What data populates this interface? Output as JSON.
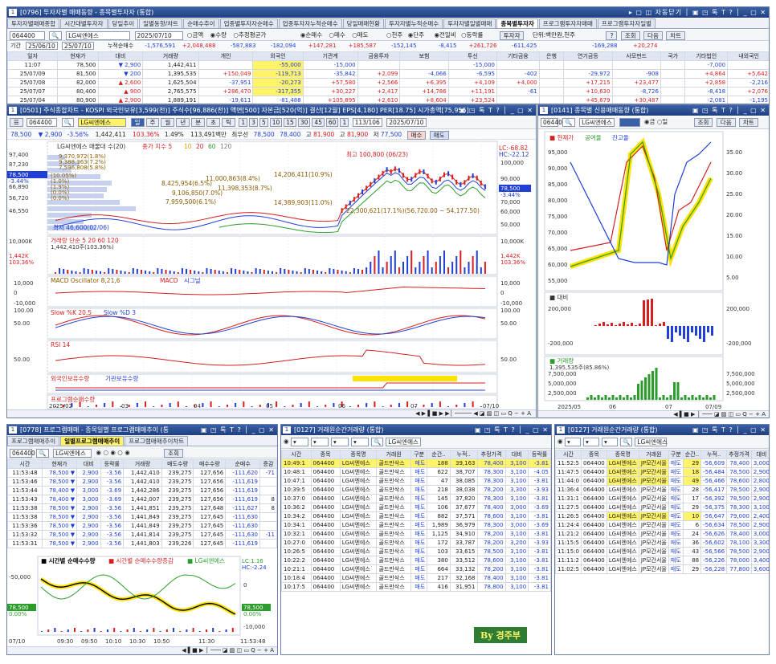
{
  "main_window": {
    "num": "1",
    "title": "[0796] 투자자별 매매동향 - 종목별투자자 (통합)",
    "ctrl": "▸ ▢ ◫ 자동닫기 │ ▣ ◳ 톡 T ? │ _ ▢ ✕"
  },
  "main_tabs": [
    "투자자별매매종합",
    "시간대별투자자",
    "당일추이",
    "일별동향/차트",
    "순매수추이",
    "업종별투자자순매수",
    "업종투자자누적순매수",
    "당일매매현황",
    "투자자별누적순매수",
    "투자자별일별매매",
    "종목별투자자",
    "프로그램투자자매매",
    "프로그램투자자일별"
  ],
  "main_toolbar": {
    "code": "064400",
    "name": "LG씨엔에스",
    "date": "2025/07/10",
    "radios": [
      "금액",
      "수량",
      "추정평균가"
    ],
    "radios2": [
      "순매수",
      "매수",
      "매도"
    ],
    "radios3": [
      "천주",
      "단주"
    ],
    "radios4": [
      "전일비",
      "등락률"
    ],
    "btn_investor": "투자자",
    "unit_note": "단위:백만원,천주",
    "query": "?",
    "btn1": "조회",
    "btn2": "다음",
    "btn3": "차트"
  },
  "period": {
    "label": "기간",
    "from": "25/06/10",
    "to": "25/07/10",
    "cum_label": "누적순매수",
    "sums": [
      "-1,576,591",
      "+2,048,488",
      "-587,883",
      "-182,094",
      "+147,281",
      "+185,587",
      "-152,145",
      "-8,415",
      "+261,726",
      "-611,425",
      "",
      "-169,288",
      "+20,274"
    ]
  },
  "main_table": {
    "headers": [
      "일자",
      "현재가",
      "대비",
      "거래량",
      "개인",
      "외국인",
      "기관계",
      "금융투자",
      "보험",
      "투신",
      "기타금융",
      "은행",
      "연기금등",
      "사모펀드",
      "국가",
      "기타법인",
      "내외국인"
    ],
    "rows": [
      [
        "11:07",
        "78,500",
        "▼ 2,900",
        "1,442,411",
        "",
        "-55,000",
        "-15,000",
        "",
        "",
        "-15,000",
        "",
        "",
        "",
        "",
        "",
        "-7,000",
        ""
      ],
      [
        "25/07/09",
        "81,500",
        "▼ 200",
        "1,395,535",
        "+150,049",
        "-119,713",
        "-35,842",
        "+2,099",
        "-4,066",
        "-6,595",
        "-402",
        "",
        "-29,972",
        "-908",
        "",
        "+4,864",
        "+5,642"
      ],
      [
        "25/07/08",
        "82,000",
        "▲ 2,600",
        "1,625,504",
        "-37,951",
        "-20,273",
        "+57,580",
        "+2,566",
        "+6,395",
        "+4,109",
        "+4,000",
        "",
        "+17,215",
        "+23,477",
        "",
        "+2,858",
        "-2,216"
      ],
      [
        "25/07/07",
        "80,400",
        "▲ 900",
        "2,765,575",
        "+286,470",
        "-317,355",
        "+30,227",
        "+2,417",
        "+14,786",
        "+11,191",
        "-61",
        "",
        "+10,630",
        "-8,726",
        "",
        "-8,418",
        "+2,076"
      ],
      [
        "25/07/04",
        "80,900",
        "▲ 2,900",
        "1,889,191",
        "-19,611",
        "-81,488",
        "+105,895",
        "+2,610",
        "+8,604",
        "+23,524",
        "",
        "",
        "+45,679",
        "+30,487",
        "",
        "-2,081",
        "-1,195"
      ]
    ]
  },
  "chart_window": {
    "num": "1",
    "title": "[0501] 주식종합차트 - KOSPI 외국인보유[3,599(천)] 주식수[96,886(천)] 액면[500] 자본금[520(억)] 결산[12월] EPS[4,180] PER[18.75] 시가총액[75,955]",
    "ctrl": "▣ ◳ 톡 T ? │ _ ▢ ✕"
  },
  "chart_toolbar": {
    "code": "064400",
    "name": "LG씨엔에스",
    "periods": [
      "일",
      "주",
      "월",
      "년",
      "분",
      "초",
      "틱"
    ],
    "nums": [
      "1",
      "3",
      "5",
      "10",
      "15",
      "30",
      "45",
      "60",
      "1"
    ],
    "count": "113/106",
    "date": "2025/07/10"
  },
  "quote": {
    "price": "78,500",
    "change": "▼ 2,900",
    "pct": "-3.56%",
    "volume": "1,442,411",
    "vol_pct": "103.36%",
    "vol_ratio": "1.49%",
    "amount": "113,491백만",
    "close_label": "최우선",
    "ask": "78,500",
    "bid": "78,400",
    "high_label": "고",
    "high": "81,900",
    "high2": "81,900",
    "low_label": "저",
    "low": "77,500",
    "buy": "매수",
    "sell": "매도"
  },
  "price_panel": {
    "legend": [
      "LG씨엔에스 매물대 수(20)",
      "종가 지수 5",
      "10",
      "20",
      "60",
      "120"
    ],
    "lc": "LC:-68.82",
    "hc": "HC:-22.12",
    "current_price": "78,500",
    "current_change": "-3.44%",
    "left_axis": [
      "97,400",
      "87,230",
      "78,500",
      "-3.44%",
      "66,890",
      "56,720",
      "46,550"
    ],
    "right_axis": [
      "100,000",
      "90,000",
      "78,500",
      "-3.44%",
      "70,000",
      "60,000",
      "50,000"
    ],
    "annotations": [
      "최고 100,800 (06/23)",
      "11,000,863(8.4%)",
      "14,206,411(10.9%)",
      "8,425,954(6.5%)",
      "11,398,353(8.7%)",
      "9,106,850(7.0%)",
      "7,959,500(6.1%)",
      "14,389,903(11.0%)",
      "22,300,621(17.1%)(56,720.00 ~ 54,177.50)",
      "최저 46,600(02/06)"
    ],
    "vol_left": "9,370,972(1.8%)",
    "vol_left2": "9,388,363(7.2%)",
    "vol_left3": "7,596,808(5.8%)",
    "pcts": [
      "(10.05%)",
      "(1.0%)",
      "(1.9%)",
      "(0.0%)",
      "(0.0%)"
    ]
  },
  "volume_panel": {
    "legend": "거래량 단순 5 20 60 120",
    "value": "1,442,410주(103.36%)",
    "left_axis": [
      "10,000K",
      "1,442K",
      "103.36%"
    ],
    "right_axis": [
      "10,000K",
      "1,442K",
      "103.36%"
    ]
  },
  "macd_panel": {
    "legend": [
      "MACD Oscillator 8,21,6",
      "MACD",
      "시그널"
    ],
    "left_axis": [
      "10,000",
      "0",
      "-10,000"
    ],
    "right_axis": [
      "10,000",
      "0",
      "-10,000"
    ]
  },
  "slow_panel": {
    "legend": [
      "Slow %K 20,5",
      "Slow %D 3"
    ],
    "left_axis": [
      "100.00",
      "50.00"
    ],
    "right_axis": [
      "100.00",
      "50.00"
    ]
  },
  "rsi_panel": {
    "legend": "RSI 14",
    "left_axis": [
      "50.00"
    ],
    "right_axis": [
      "50.00"
    ]
  },
  "foreign_panel": {
    "legend": [
      "외국인보유수량",
      "기관보유수량"
    ]
  },
  "program_panel": {
    "legend": "프로그램순매수량"
  },
  "x_axis": [
    "2025/02",
    "03",
    "04",
    "05",
    "06",
    "07",
    "07/10"
  ],
  "credit_window": {
    "num": "1",
    "title": "[0141] 종목별 신용매매동향 (통합)",
    "ctrl": "▣ ◳ 톡 T ? │ _ ▢ ✕"
  },
  "credit_toolbar": {
    "code": "064400",
    "name": "LG씨엔에스",
    "radios": [
      "금",
      "O",
      "일"
    ],
    "btn1": "조회",
    "btn2": "다음",
    "btn3": "차트"
  },
  "credit_panel": {
    "legend": [
      "현재가",
      "공여율",
      "잔고율"
    ],
    "left_axis": [
      "95,000",
      "90,000",
      "85,000",
      "80,000",
      "75,000",
      "70,000",
      "65,000",
      "60,000",
      "55,000"
    ],
    "right_axis": [
      "35.00",
      "30.00",
      "25.00",
      "20.00",
      "15.00",
      "10.00",
      "5.00"
    ],
    "diff_legend": "대비",
    "diff_axis": [
      "200,000",
      "-200,000"
    ],
    "diff_axis_r": [
      "200,000",
      "-200,000"
    ],
    "vol_legend": "거래량",
    "vol_value": "1,395,535주(85.86%)",
    "vol_axis": [
      "7,500,000",
      "5,000,000",
      "2,500,000"
    ],
    "x": [
      "2025/05",
      "06",
      "07",
      "07/09"
    ]
  },
  "program_window": {
    "num": "1",
    "title": "[0778] 프로그램매매 - 종목일별 프로그램매매추이 (통",
    "ctrl": "▣ ◳ 톡 T ? │ _ ▢ ✕"
  },
  "program_tabs": [
    "프로그램매매추이",
    "일별프로그램매매추이",
    "프로그램매매추이차트"
  ],
  "program_table": {
    "headers": [
      "시간",
      "현재가",
      "대비",
      "등락률",
      "거래량",
      "매도수량",
      "매수수량",
      "순매수",
      "증감"
    ],
    "rows": [
      [
        "11:53:48",
        "78,500 ▼",
        "2,900",
        "-3.56",
        "1,442,410",
        "239,275",
        "127,656",
        "-111,620",
        "-71"
      ],
      [
        "11:53:46",
        "78,500 ▼",
        "2,900",
        "-3.56",
        "1,442,410",
        "239,275",
        "127,656",
        "-111,619",
        ""
      ],
      [
        "11:53:44",
        "78,400 ▼",
        "3,000",
        "-3.69",
        "1,442,286",
        "239,275",
        "127,656",
        "-111,619",
        ""
      ],
      [
        "11:53:43",
        "78,400 ▼",
        "3,000",
        "-3.69",
        "1,442,007",
        "239,275",
        "127,656",
        "-111,619",
        "8"
      ],
      [
        "11:53:38",
        "78,500 ▼",
        "2,900",
        "-3.56",
        "1,441,851",
        "239,275",
        "127,648",
        "-111,627",
        "8"
      ],
      [
        "11:53:38",
        "78,500 ▼",
        "2,900",
        "-3.56",
        "1,441,849",
        "239,275",
        "127,645",
        "-111,630",
        ""
      ],
      [
        "11:53:36",
        "78,500 ▼",
        "2,900",
        "-3.56",
        "1,441,849",
        "239,275",
        "127,645",
        "-111,630",
        ""
      ],
      [
        "11:53:32",
        "78,500 ▼",
        "2,900",
        "-3.56",
        "1,441,814",
        "239,275",
        "127,645",
        "-111,630",
        "-11"
      ],
      [
        "11:53:31",
        "78,500 ▼",
        "2,900",
        "-3.56",
        "1,441,803",
        "239,226",
        "127,645",
        "-111,619",
        ""
      ]
    ]
  },
  "program_chart": {
    "legend": [
      "시간별 순매수수량",
      "시간별 순매수수량증감",
      "LG씨엔에스"
    ],
    "lc": "LC:1.16",
    "hc": "HC:-2.24",
    "left_axis": [
      "-50,000",
      "78,500",
      "0.00%"
    ],
    "right_axis": [
      "0",
      "78,500",
      "0.00%",
      "-10,000"
    ],
    "x": [
      "07/10",
      "09:30",
      "09:50",
      "10:10",
      "10:30",
      "10:50",
      "11:30",
      "11:53:48"
    ]
  },
  "trade_window1": {
    "num": "1",
    "title": "[0127] 거래원순간거래량 (통합)",
    "ctrl": "▣ ◳ 톡 T ? │ _ ▢ ✕"
  },
  "trade_window2": {
    "num": "1",
    "title": "[0127] 거래원순간거래량 (통합)",
    "ctrl": "▣ ◳ 톡 T ? │ _ ▢ ✕"
  },
  "trade_headers": [
    "시간",
    "종목",
    "종목명",
    "거래원",
    "구분",
    "순간..",
    "누적..",
    "추정가격",
    "대비",
    "등락률"
  ],
  "trade_rows1": [
    [
      "10:49:1",
      "064400",
      "LG씨엔에스",
      "골드만삭스",
      "매도",
      "188",
      "39,163",
      "78,400",
      "3,100",
      "-3.81"
    ],
    [
      "10:48:1",
      "064400",
      "LG씨엔에스",
      "골드만삭스",
      "매도",
      "622",
      "38,707",
      "78,300",
      "3,100",
      "-4.05"
    ],
    [
      "10:47:1",
      "064400",
      "LG씨엔에스",
      "골드만삭스",
      "매도",
      "47",
      "38,085",
      "78,300",
      "3,100",
      "-3.81"
    ],
    [
      "10:39:5",
      "064400",
      "LG씨엔에스",
      "골드만삭스",
      "매도",
      "218",
      "38,038",
      "78,200",
      "3,300",
      "-3.93"
    ],
    [
      "10:37:0",
      "064400",
      "LG씨엔에스",
      "골드만삭스",
      "매도",
      "145",
      "37,820",
      "78,300",
      "3,100",
      "-3.81"
    ],
    [
      "10:36:2",
      "064400",
      "LG씨엔에스",
      "골드만삭스",
      "매도",
      "106",
      "37,677",
      "78,400",
      "3,000",
      "-3.69"
    ],
    [
      "10:34:2",
      "064400",
      "LG씨엔에스",
      "골드만삭스",
      "매도",
      "882",
      "37,571",
      "78,600",
      "3,100",
      "-3.81"
    ],
    [
      "10:34:1",
      "064400",
      "LG씨엔에스",
      "골드만삭스",
      "매도",
      "1,989",
      "36,979",
      "78,300",
      "3,000",
      "-3.69"
    ],
    [
      "10:32:1",
      "064400",
      "LG씨엔에스",
      "골드만삭스",
      "매도",
      "1,125",
      "34,910",
      "78,200",
      "3,100",
      "-3.81"
    ],
    [
      "10:27:0",
      "064400",
      "LG씨엔에스",
      "골드만삭스",
      "매도",
      "172",
      "33,787",
      "78,200",
      "3,200",
      "-3.93"
    ],
    [
      "10:26:5",
      "064400",
      "LG씨엔에스",
      "골드만삭스",
      "매도",
      "103",
      "33,615",
      "78,500",
      "3,100",
      "-3.81"
    ],
    [
      "10:22:2",
      "064400",
      "LG씨엔에스",
      "골드만삭스",
      "매도",
      "380",
      "33,512",
      "78,600",
      "3,100",
      "-3.81"
    ],
    [
      "10:21:1",
      "064400",
      "LG씨엔에스",
      "골드만삭스",
      "매도",
      "664",
      "33,132",
      "78,200",
      "3,100",
      "-3.81"
    ],
    [
      "10:18:4",
      "064400",
      "LG씨엔에스",
      "골드만삭스",
      "매도",
      "217",
      "32,168",
      "78,400",
      "3,100",
      "-3.81"
    ],
    [
      "10:17:5",
      "064400",
      "LG씨엔에스",
      "골드만삭스",
      "매도",
      "416",
      "31,951",
      "78,800",
      "3,100",
      "-3.81"
    ]
  ],
  "trade_rows2": [
    [
      "11:52:5",
      "064400",
      "LG씨엔에스",
      "JP모간서울",
      "매도",
      "29",
      "-56,609",
      "78,400",
      "3,000",
      "-3.69"
    ],
    [
      "11:47:5",
      "064400",
      "LG씨엔에스",
      "JP모간서울",
      "매도",
      "18",
      "-56,484",
      "78,500",
      "2,900",
      "-3.56"
    ],
    [
      "11:44:0",
      "064400",
      "LG씨엔에스",
      "JP모간서울",
      "매도",
      "49",
      "-56,466",
      "78,600",
      "2,800",
      "-3.44"
    ],
    [
      "11:36:4",
      "064400",
      "LG씨엔에스",
      "JP모간서울",
      "매도",
      "28",
      "-56,417",
      "78,500",
      "2,900",
      "-3.56"
    ],
    [
      "11:31:1",
      "064400",
      "LG씨엔에스",
      "JP모간서울",
      "매도",
      "17",
      "-56,392",
      "78,500",
      "2,900",
      "-3.56"
    ],
    [
      "11:27:5",
      "064400",
      "LG씨엔에스",
      "JP모간서울",
      "매도",
      "29",
      "-56,375",
      "78,300",
      "3,100",
      "-3.81"
    ],
    [
      "11:26:5",
      "064400",
      "LG씨엔에스",
      "JP모간서울",
      "매도",
      "10",
      "-56,647",
      "79,000",
      "2,400",
      "-2.95"
    ],
    [
      "11:24:4",
      "064400",
      "LG씨엔에스",
      "JP모간서울",
      "매도",
      "6",
      "-56,634",
      "78,500",
      "2,900",
      "-3.56"
    ],
    [
      "11:21:2",
      "064400",
      "LG씨엔에스",
      "JP모간서울",
      "매도",
      "24",
      "-56,626",
      "78,400",
      "3,000",
      "-3.69"
    ],
    [
      "11:15:5",
      "064400",
      "LG씨엔에스",
      "JP모간서울",
      "매도",
      "36",
      "-56,602",
      "78,100",
      "3,300",
      "-4.05"
    ],
    [
      "11:15:0",
      "064400",
      "LG씨엔에스",
      "JP모간서울",
      "매도",
      "43",
      "-56,566",
      "78,500",
      "2,900",
      "-3.56"
    ],
    [
      "11:11:2",
      "064400",
      "LG씨엔에스",
      "JP모간서울",
      "매도",
      "88",
      "-56,226",
      "78,000",
      "3,400",
      "-4.18"
    ],
    [
      "11:02:5",
      "064400",
      "LG씨엔에스",
      "JP모간서울",
      "매도",
      "29",
      "-56,228",
      "77,800",
      "3,600",
      "-4.42"
    ]
  ],
  "watermark": "By 경주부",
  "colors": {
    "up": "#d61f1f",
    "down": "#1f3fd6",
    "title": "#1f3f7f",
    "highlight": "#fff36a"
  }
}
